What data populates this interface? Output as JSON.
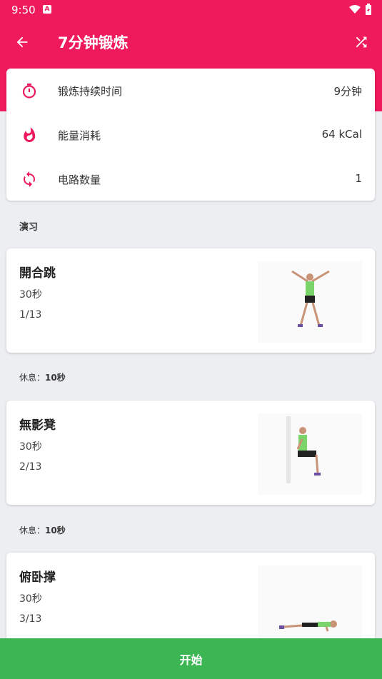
{
  "status_bar": {
    "time": "9:50"
  },
  "app_bar": {
    "title": "7分钟锻炼"
  },
  "stats": [
    {
      "label": "锻炼持续时间",
      "value": "9分钟",
      "icon": "stopwatch-icon"
    },
    {
      "label": "能量消耗",
      "value": "64 kCal",
      "icon": "flame-icon"
    },
    {
      "label": "电路数量",
      "value": "1",
      "icon": "cycle-icon"
    }
  ],
  "section": {
    "label": "演习"
  },
  "exercises": [
    {
      "name": "開合跳",
      "duration": "30秒",
      "index": "1/13"
    },
    {
      "name": "無影凳",
      "duration": "30秒",
      "index": "2/13"
    },
    {
      "name": "俯卧撑",
      "duration": "30秒",
      "index": "3/13"
    }
  ],
  "rests": [
    {
      "label": "休息：",
      "value": "10秒"
    },
    {
      "label": "休息：",
      "value": "10秒"
    }
  ],
  "start_button": {
    "label": "开始"
  },
  "colors": {
    "primary": "#ef1a5c",
    "accent_green": "#3cb653",
    "background": "#eceef1"
  }
}
